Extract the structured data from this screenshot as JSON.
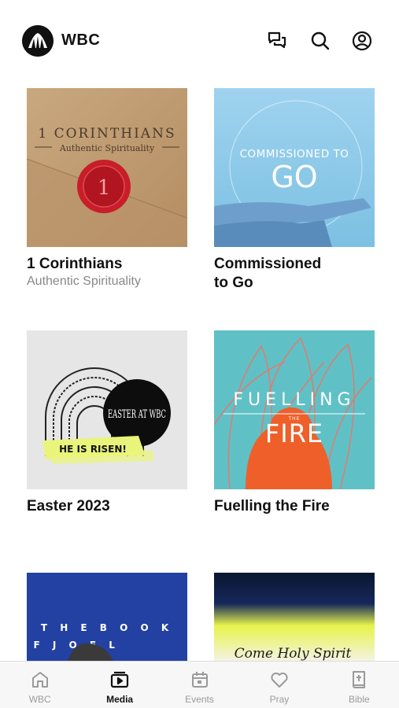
{
  "header": {
    "brand": "WBC",
    "icons": [
      "logo-icon",
      "chat-icon",
      "search-icon",
      "profile-icon"
    ]
  },
  "series": [
    {
      "title": "1 Corinthians",
      "subtitle": "Authentic Spirituality",
      "art_heading": "1 CORINTHIANS",
      "art_sub": "Authentic Spirituality",
      "seal_text": "1"
    },
    {
      "title": "Commissioned\nto Go",
      "art_heading": "COMMISSIONED TO",
      "art_big": "GO"
    },
    {
      "title": "Easter 2023",
      "art_badge": "EASTER AT WBC",
      "art_banner": "HE IS RISEN!"
    },
    {
      "title": "Fuelling the Fire",
      "art_top": "FUELLING",
      "art_small": "THE",
      "art_big": "FIRE"
    },
    {
      "art_line1": "T H E   B O O K",
      "art_line2": "O F   J O E L"
    },
    {
      "art_script": "Come Holy Spirit"
    }
  ],
  "tabs": [
    {
      "label": "WBC",
      "icon": "home-icon",
      "active": false
    },
    {
      "label": "Media",
      "icon": "media-icon",
      "active": true
    },
    {
      "label": "Events",
      "icon": "calendar-icon",
      "active": false
    },
    {
      "label": "Pray",
      "icon": "heart-icon",
      "active": false
    },
    {
      "label": "Bible",
      "icon": "bible-icon",
      "active": false
    }
  ],
  "colors": {
    "active_tab": "#111111",
    "inactive_tab": "#9a9a9a",
    "tabbar_bg": "#f7f7f7"
  }
}
